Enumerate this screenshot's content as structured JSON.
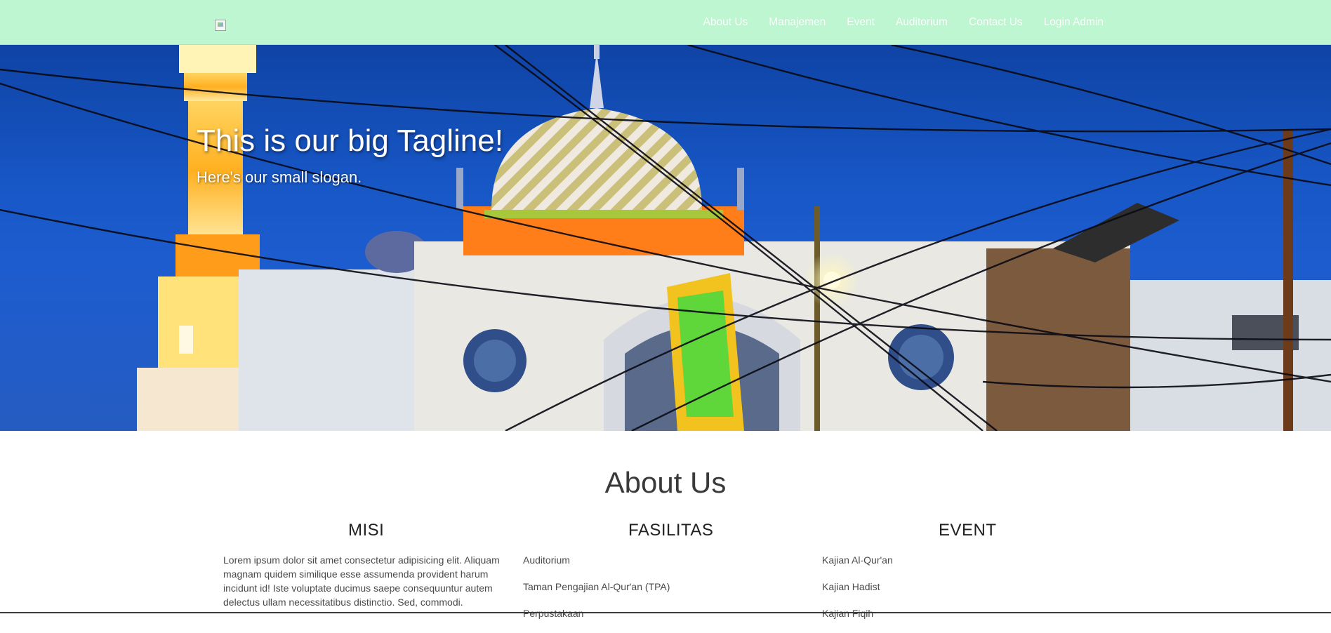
{
  "navbar": {
    "brand_logo": "broken-image-icon",
    "links": [
      "About Us",
      "Manajemen",
      "Event",
      "Auditorium",
      "Contact Us",
      "Login Admin"
    ],
    "background": "#bdf6d1",
    "link_color": "#ffffff"
  },
  "hero": {
    "title": "This is our big Tagline!",
    "slogan": "Here's our small slogan."
  },
  "about": {
    "title": "About Us",
    "columns": [
      {
        "heading": "MISI",
        "text": "Lorem ipsum dolor sit amet consectetur adipisicing elit. Aliquam magnam quidem similique esse assumenda provident harum incidunt id! Iste voluptate ducimus saepe consequuntur autem delectus ullam necessitatibus distinctio. Sed, commodi."
      },
      {
        "heading": "FASILITAS",
        "items": [
          "Auditorium",
          "Taman Pengajian Al-Qur'an (TPA)",
          "Perpustakaan"
        ]
      },
      {
        "heading": "EVENT",
        "items": [
          "Kajian Al-Qur'an",
          "Kajian Hadist",
          "Kajian Fiqih"
        ]
      }
    ]
  }
}
